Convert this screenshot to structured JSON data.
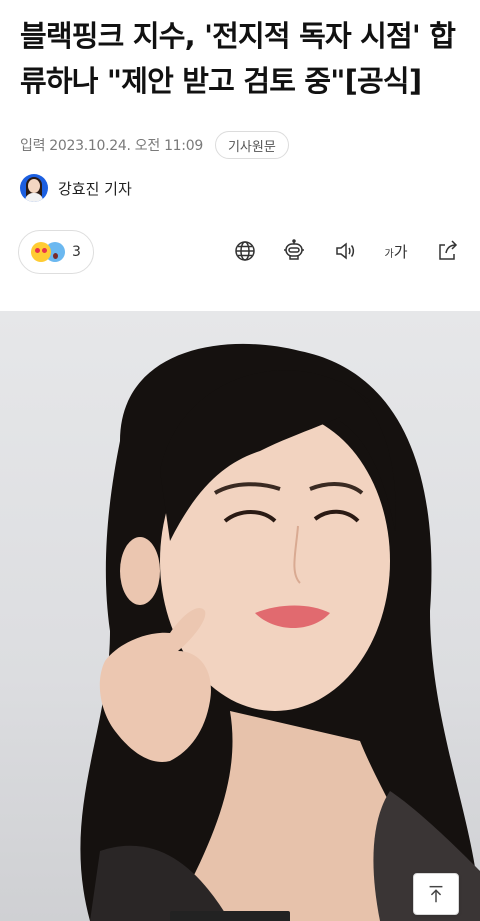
{
  "article": {
    "headline": "블랙핑크 지수, '전지적 독자 시점' 합류하나 \"제안 받고 검토 중\"[공식]",
    "date_label": "입력 2023.10.24. 오전 11:09",
    "original_label": "기사원문",
    "reporter": "강효진 기자"
  },
  "toolbar": {
    "reaction_count": "3",
    "reaction_icons": [
      "heart-eyes-emoji",
      "shocked-emoji"
    ],
    "icons": [
      "globe-icon",
      "robot-summary-icon",
      "speaker-icon",
      "font-size-icon",
      "share-icon"
    ],
    "font_size_small": "가",
    "font_size_large": "가"
  },
  "photo": {
    "description_icon": "photo"
  },
  "scroll_top": {
    "icon": "arrow-up-icon"
  },
  "colors": {
    "accent": "#1c5fe0",
    "text": "#111111",
    "muted": "#7a7a7a",
    "border": "#dedede"
  }
}
